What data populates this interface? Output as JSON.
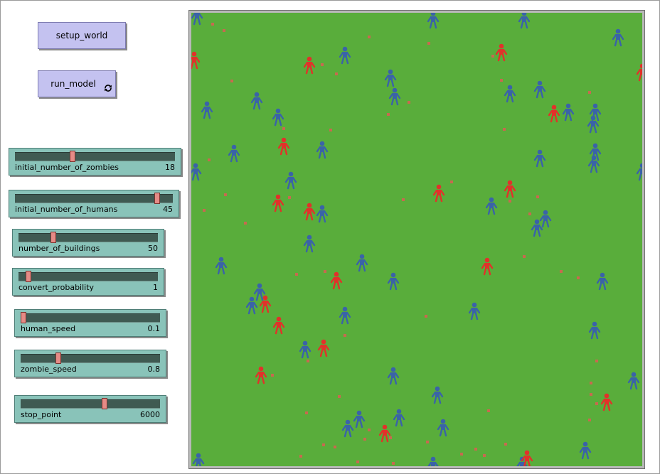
{
  "buttons": {
    "setup_label": "setup_world",
    "run_label": "run_model",
    "run_icon": "forever-icon"
  },
  "sliders": [
    {
      "name": "initial_number_of_zombies",
      "value": "18",
      "fraction": 0.36
    },
    {
      "name": "initial_number_of_humans",
      "value": "45",
      "fraction": 0.9
    },
    {
      "name": "number_of_buildings",
      "value": "50",
      "fraction": 0.25
    },
    {
      "name": "convert_probability",
      "value": "1",
      "fraction": 0.07
    },
    {
      "name": "human_speed",
      "value": "0.1",
      "fraction": 0.02
    },
    {
      "name": "zombie_speed",
      "value": "0.8",
      "fraction": 0.27
    },
    {
      "name": "stop_point",
      "value": "6000",
      "fraction": 0.6
    }
  ],
  "world": {
    "background_color": "#59ad3b",
    "human_color": "#3a63a8",
    "zombie_color": "#e2312a",
    "building_color": "#c76a4f",
    "agent_icon": "person-icon",
    "building_icon": "building-patch-icon"
  }
}
